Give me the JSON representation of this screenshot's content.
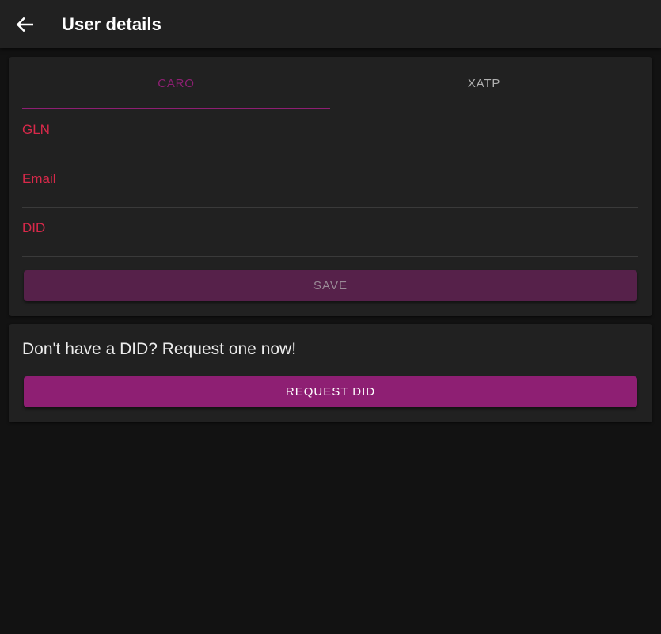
{
  "app_bar": {
    "title": "User details",
    "back_icon": "arrow-left-icon"
  },
  "tabs": [
    {
      "label": "CARO",
      "active": true
    },
    {
      "label": "XATP",
      "active": false
    }
  ],
  "form": {
    "fields": [
      {
        "label": "GLN",
        "value": ""
      },
      {
        "label": "Email",
        "value": ""
      },
      {
        "label": "DID",
        "value": ""
      }
    ],
    "save_label": "SAVE"
  },
  "request": {
    "prompt": "Don't have a DID? Request one now!",
    "button_label": "REQUEST DID"
  },
  "colors": {
    "accent": "#8e1f73",
    "error_label": "#d9294a",
    "surface": "#212121",
    "background": "#121212"
  }
}
